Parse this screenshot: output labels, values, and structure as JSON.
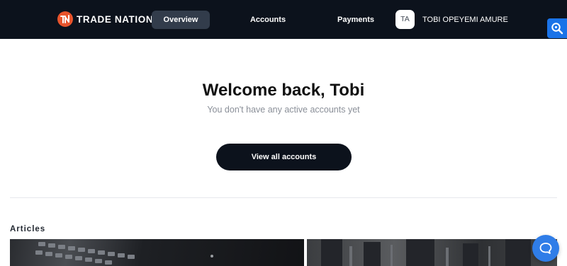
{
  "header": {
    "brand": "TRADE NATION",
    "nav": [
      {
        "label": "Overview",
        "active": true
      },
      {
        "label": "Accounts",
        "active": false
      },
      {
        "label": "Payments",
        "active": false
      }
    ],
    "user": {
      "initials": "TA",
      "name": "TOBI OPEYEMI AMURE"
    }
  },
  "main": {
    "welcome_title": "Welcome back, Tobi",
    "welcome_subtitle": "You don't have any active accounts yet",
    "view_accounts_button": "View all accounts",
    "articles_heading": "Articles"
  },
  "icons": {
    "brand_logo": "trade-nation-logo-icon",
    "helper_tab": "magnifier-icon",
    "chat": "chat-bubble-icon"
  },
  "colors": {
    "header_bg": "#0c121c",
    "nav_active_bg": "#323c4b",
    "brand_orange": "#e8542c",
    "cta_bg": "#0c121c",
    "helper_blue": "#1a73e8",
    "chat_blue": "#2f7de8",
    "subtitle_gray": "#8a8f98"
  }
}
